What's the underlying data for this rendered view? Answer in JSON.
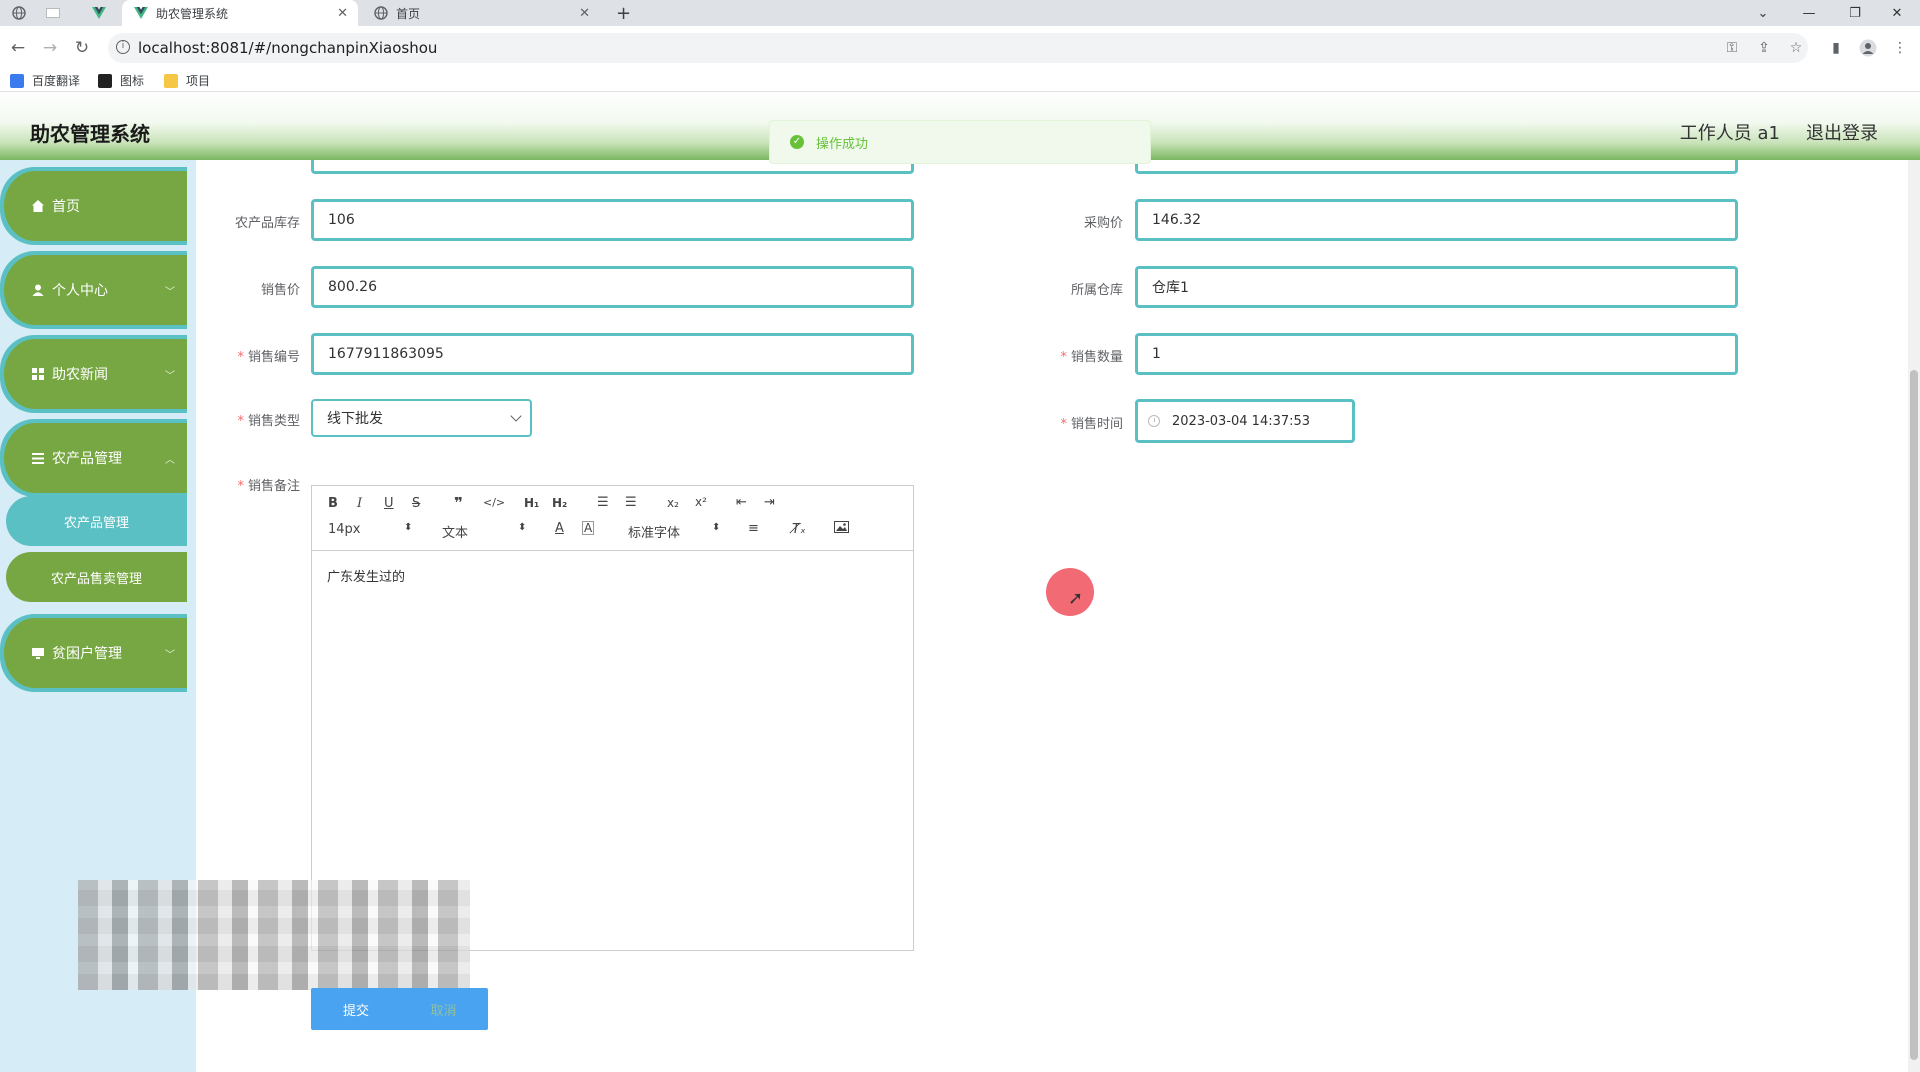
{
  "browser": {
    "tabs": [
      {
        "title": "",
        "icon": "globe-icon"
      },
      {
        "title": "",
        "icon": "blank-icon"
      },
      {
        "title": "",
        "icon": "vue-icon"
      },
      {
        "title": "助农管理系统",
        "icon": "vue-icon",
        "active": true
      },
      {
        "title": "首页",
        "icon": "globe-icon"
      }
    ],
    "new_tab": "+",
    "url": "localhost:8081/#/nongchanpinXiaoshou",
    "bookmarks": [
      "百度翻译",
      "图标",
      "项目"
    ]
  },
  "header": {
    "title": "助农管理系统",
    "user": "工作人员 a1",
    "logout": "退出登录"
  },
  "toast": {
    "message": "操作成功",
    "color": "#67c23a"
  },
  "sidebar": {
    "items": [
      {
        "label": "首页",
        "icon": "home-icon"
      },
      {
        "label": "个人中心",
        "icon": "user-icon"
      },
      {
        "label": "助农新闻",
        "icon": "grid-icon"
      },
      {
        "label": "农产品管理",
        "icon": "list-icon"
      },
      {
        "label": "贫困户管理",
        "icon": "monitor-icon"
      }
    ],
    "sub_items": [
      {
        "label": "农产品管理",
        "active": true
      },
      {
        "label": "农产品售卖管理",
        "active": false
      }
    ]
  },
  "form": {
    "stock_label": "农产品库存",
    "stock_value": "106",
    "purchase_label": "采购价",
    "purchase_value": "146.32",
    "sale_price_label": "销售价",
    "sale_price_value": "800.26",
    "warehouse_label": "所属仓库",
    "warehouse_value": "仓库1",
    "sale_no_label": "销售编号",
    "sale_no_value": "1677911863095",
    "sale_qty_label": "销售数量",
    "sale_qty_value": "1",
    "sale_type_label": "销售类型",
    "sale_type_value": "线下批发",
    "sale_time_label": "销售时间",
    "sale_time_value": "2023-03-04 14:37:53",
    "remark_label": "销售备注",
    "required_mark": "*"
  },
  "editor": {
    "font_size": "14px",
    "text_type": "文本",
    "font_family": "标准字体",
    "content": "广东发生过的"
  },
  "buttons": {
    "submit": "提交",
    "cancel": "取消"
  },
  "colors": {
    "accent": "#5bc0c4",
    "menu_green": "#77a742",
    "primary_button": "#4aa3f0"
  }
}
